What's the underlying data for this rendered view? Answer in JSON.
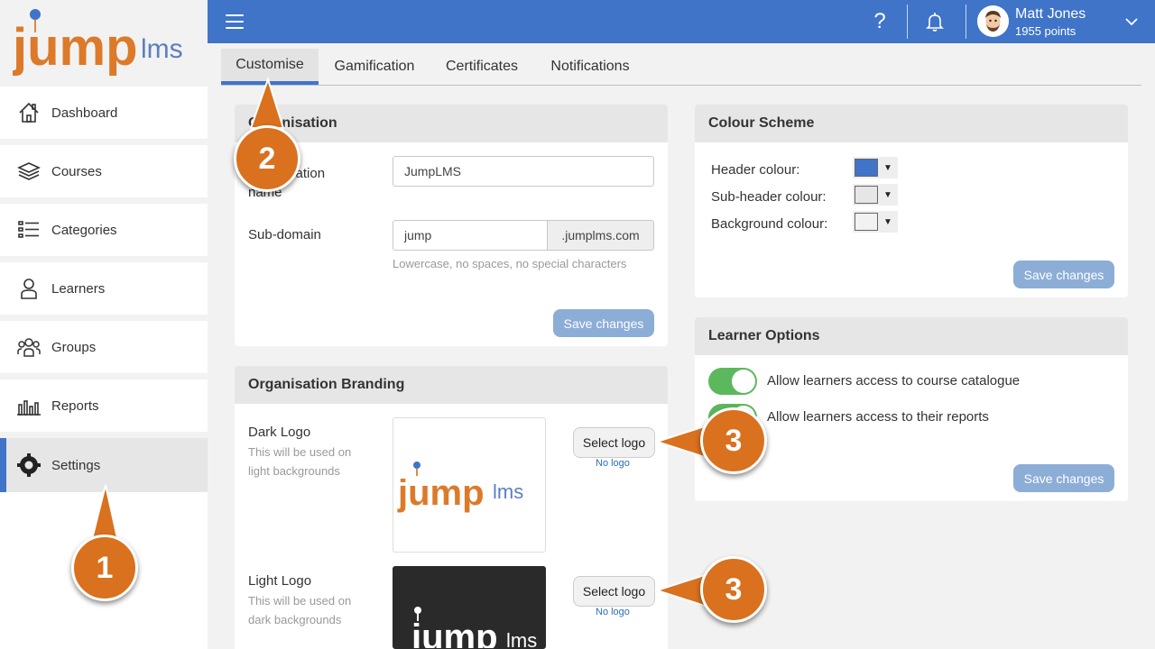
{
  "app": {
    "logo_text": "jumplms"
  },
  "sidebar": {
    "items": [
      {
        "label": "Dashboard",
        "icon": "home-icon"
      },
      {
        "label": "Courses",
        "icon": "layers-icon"
      },
      {
        "label": "Categories",
        "icon": "list-icon"
      },
      {
        "label": "Learners",
        "icon": "person-icon"
      },
      {
        "label": "Groups",
        "icon": "people-icon"
      },
      {
        "label": "Reports",
        "icon": "bar-chart-icon"
      },
      {
        "label": "Settings",
        "icon": "gear-icon",
        "active": true
      }
    ]
  },
  "header": {
    "help_glyph": "?",
    "user_name": "Matt Jones",
    "user_points": "1955 points",
    "accent_color": "#3f74c8"
  },
  "tabs": [
    {
      "label": "Customise",
      "active": true
    },
    {
      "label": "Gamification"
    },
    {
      "label": "Certificates"
    },
    {
      "label": "Notifications"
    }
  ],
  "organisation": {
    "title": "Organisation",
    "name_label": "Organisation name",
    "name_value": "JumpLMS",
    "subdomain_label": "Sub-domain",
    "subdomain_value": "jump",
    "subdomain_suffix": ".jumplms.com",
    "subdomain_hint": "Lowercase, no spaces, no special characters",
    "save_label": "Save changes"
  },
  "branding": {
    "title": "Organisation Branding",
    "dark_logo_label": "Dark Logo",
    "dark_logo_hint": "This will be used on light backgrounds",
    "light_logo_label": "Light Logo",
    "light_logo_hint": "This will be used on dark backgrounds",
    "select_label": "Select logo",
    "no_logo_label": "No logo",
    "logo_text_main": "jump",
    "logo_text_sub": "lms"
  },
  "colour_scheme": {
    "title": "Colour Scheme",
    "rows": [
      {
        "label": "Header colour:",
        "color": "#3f74c8"
      },
      {
        "label": "Sub-header colour:",
        "color": "#e6e6e6"
      },
      {
        "label": "Background colour:",
        "color": "#f2f2f2"
      }
    ],
    "save_label": "Save changes"
  },
  "learner_options": {
    "title": "Learner Options",
    "options": [
      {
        "label": "Allow learners access to course catalogue",
        "enabled": true
      },
      {
        "label": "Allow learners access to their reports",
        "enabled": true
      }
    ],
    "save_label": "Save changes"
  },
  "callouts": {
    "one": "1",
    "two": "2",
    "three_a": "3",
    "three_b": "3",
    "color": "#d9711e"
  }
}
